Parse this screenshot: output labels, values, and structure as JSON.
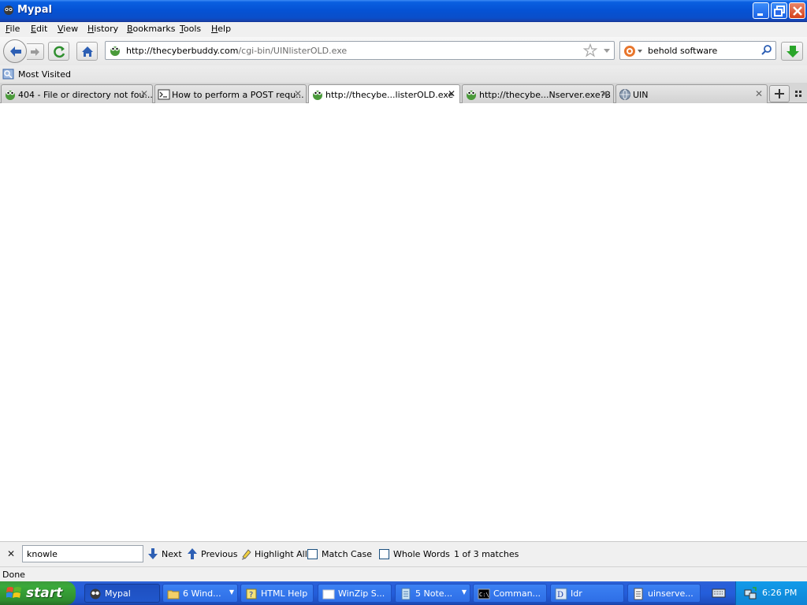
{
  "window": {
    "title": "Mypal"
  },
  "menu": [
    {
      "label": "File",
      "accel": "F",
      "rest": "ile"
    },
    {
      "label": "Edit",
      "accel": "E",
      "rest": "dit"
    },
    {
      "label": "View",
      "accel": "V",
      "rest": "iew"
    },
    {
      "label": "History",
      "accel": "H",
      "rest": "istory"
    },
    {
      "label": "Bookmarks",
      "accel": "B",
      "rest": "ookmarks"
    },
    {
      "label": "Tools",
      "accel": "T",
      "rest": "ools"
    },
    {
      "label": "Help",
      "accel": "H",
      "rest": "elp"
    }
  ],
  "nav": {
    "url_host": "http://thecyberbuddy.com",
    "url_path": "/cgi-bin/UINlisterOLD.exe",
    "search_query": "behold software"
  },
  "bookmarks": {
    "most_visited": "Most Visited"
  },
  "tabs": [
    {
      "label": "404 - File or directory not fou...",
      "icon": "frog-icon",
      "active": false
    },
    {
      "label": "How to perform a POST requ...",
      "icon": "terminal-icon",
      "active": false
    },
    {
      "label": "http://thecybe...listerOLD.exe",
      "icon": "frog-icon",
      "active": true
    },
    {
      "label": "http://thecybe...Nserver.exe?B",
      "icon": "frog-icon",
      "active": false
    },
    {
      "label": "UIN",
      "icon": "globe-icon",
      "active": false
    }
  ],
  "findbar": {
    "query": "knowle",
    "next": "Next",
    "previous": "Previous",
    "highlight_all": "Highlight All",
    "match_case": "Match Case",
    "whole_words": "Whole Words",
    "status": "1 of 3 matches"
  },
  "status": {
    "text": "Done"
  },
  "taskbar": {
    "start": "start",
    "items": [
      {
        "label": "Mypal",
        "active": true,
        "arrow": false
      },
      {
        "label": "6 Wind...",
        "active": false,
        "arrow": true
      },
      {
        "label": "HTML Help",
        "active": false,
        "arrow": false
      },
      {
        "label": "WinZip S...",
        "active": false,
        "arrow": false
      },
      {
        "label": "5 Note...",
        "active": false,
        "arrow": true
      },
      {
        "label": "Comman...",
        "active": false,
        "arrow": false
      },
      {
        "label": "Idr",
        "active": false,
        "arrow": false
      },
      {
        "label": "uinserve...",
        "active": false,
        "arrow": false
      }
    ],
    "clock": "6:26 PM"
  }
}
